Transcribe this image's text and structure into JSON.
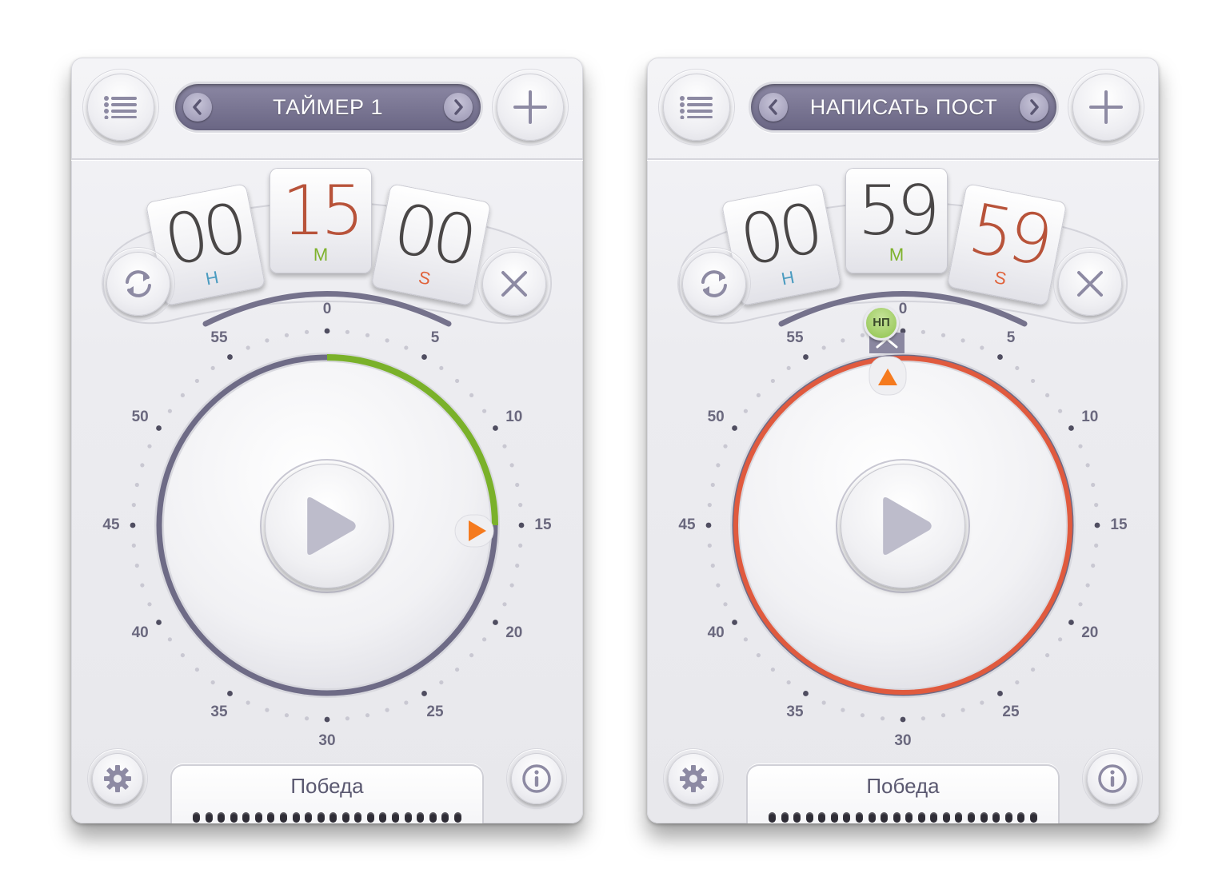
{
  "panels": [
    {
      "title": "ТАЙМЕР 1",
      "hours": "00",
      "minutes": "15",
      "seconds": "00",
      "hours_unit": "H",
      "minutes_unit": "M",
      "seconds_unit": "S",
      "status": "Победа",
      "dial_labels": [
        "0",
        "5",
        "10",
        "15",
        "20",
        "25",
        "30",
        "35",
        "40",
        "45",
        "50",
        "55"
      ],
      "progress_minutes": 15,
      "ring_state": "set",
      "accent_digit": "minutes"
    },
    {
      "title": "НАПИСАТЬ ПОСТ",
      "hours": "00",
      "minutes": "59",
      "seconds": "59",
      "hours_unit": "H",
      "minutes_unit": "M",
      "seconds_unit": "S",
      "status": "Победа",
      "dial_labels": [
        "0",
        "5",
        "10",
        "15",
        "20",
        "25",
        "30",
        "35",
        "40",
        "45",
        "50",
        "55"
      ],
      "progress_minutes": 60,
      "ring_state": "running",
      "accent_digit": "seconds",
      "badge": "НП"
    }
  ],
  "icons": {
    "menu": "list-icon",
    "add": "plus-icon",
    "prev": "chevron-left-icon",
    "next": "chevron-right-icon",
    "reset": "refresh-icon",
    "clear": "close-icon",
    "play": "play-icon",
    "settings": "gear-icon",
    "info": "info-icon"
  },
  "colors": {
    "title_bar": "#7a7694",
    "progress_green": "#7ab12a",
    "running_red": "#e05a3e",
    "marker_orange": "#f57a1e",
    "accent_digit": "#b8533a",
    "unit_h": "#4a9bc0",
    "unit_m": "#7eb22c",
    "unit_s": "#e0623a"
  }
}
